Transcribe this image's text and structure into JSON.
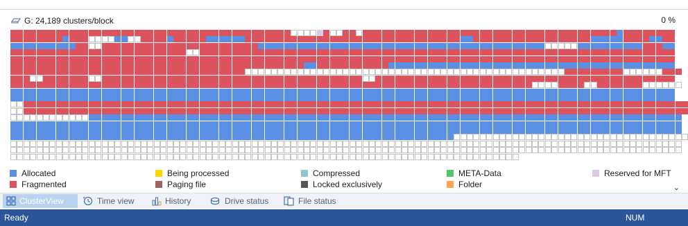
{
  "header": {
    "drive_label": "G: 24,189 clusters/block",
    "percent": "0 %"
  },
  "legend": [
    {
      "label": "Allocated",
      "color": "#5b8fe3"
    },
    {
      "label": "Fragmented",
      "color": "#dd535d"
    },
    {
      "label": "Being processed",
      "color": "#ffd700"
    },
    {
      "label": "Paging file",
      "color": "#a0645f"
    },
    {
      "label": "Compressed",
      "color": "#8fc5d6"
    },
    {
      "label": "Locked exclusively",
      "color": "#555555"
    },
    {
      "label": "META-Data",
      "color": "#52c46a"
    },
    {
      "label": "Folder",
      "color": "#ffa64d"
    },
    {
      "label": "Reserved for MFT",
      "color": "#dccbe3"
    }
  ],
  "tabs": [
    {
      "label": "ClusterView",
      "icon": "grid-icon",
      "active": true
    },
    {
      "label": "Time view",
      "icon": "clock-icon",
      "active": false
    },
    {
      "label": "History",
      "icon": "bar-chart-icon",
      "active": false
    },
    {
      "label": "Drive status",
      "icon": "drive-icon",
      "active": false
    },
    {
      "label": "File status",
      "icon": "file-icon",
      "active": false
    }
  ],
  "status": {
    "text": "Ready",
    "num": "NUM"
  },
  "colors": {
    "allocated": "#5b8fe3",
    "fragmented": "#dd535d",
    "free_border": "#c4c4c4",
    "reserved": "#dccbe3",
    "status_bar": "#2b579a",
    "active_tab": "#b8d3f0"
  },
  "cluster_map": {
    "description_codes": "A=allocated, F=fragmented, E=empty/free, R=reserved for MFT",
    "rows": [
      "FFFFFFFFFFFFFFFFFFFFFFFFFFFFFFFFFFFFFFFFFFFEEEERFEEFFEFFFFFFFFFFFFFFFFFFFFFFFFFFFFFFFFFFFFFFFAFFFFFFFF",
      "FFFFFFFFAFFFEEEEAAEEFFFFAFFFFFAAAAAAFFFFFFFFFFFFFFFFFFFFFFFFFFFFFFFFFAAFFFFFFFFFFFFFFFFFFAAAAAFFFFAAFF",
      "AAAAAAAAAAFFEEFFFFFFFFFFFFFFFFFFFFFFFFAAAAAAAAAAAAAAAAAAAAAAAAAAAAAAAAAAAAAAAAAAAAEEEEEAAAAAAAAAAFFFAA",
      "FFFFFFFFFFFFFFFFFFFFFFFFFFFEEFFFFFFFFFFFFFFFFFFFFFFFFFFFFFFFFFFFFFFFFFFFFFFFFFFFFFFFFFFFFFFFFFFFFFFFFF",
      "FFFFFFFFFFFFFFFFFFFFFFFFFFFFFFFFFFFFFFFFFFFFFFFFFFFFFFFFFFFFFFFFFFFFFFFFFFFFFFFFFFFFFFFFFFFFFFFFFFFFFF",
      "FFFFFFFFFFFFFFFFFFFFFFFFFFFFFFFFFFFFFFFFFFFFFAAFFFFFFFFFFFAAAAAAAAAAAAAAAAAAAAAAAAAAAAAAAAAAAAAAAAAAAA",
      "FFFFFFFFFFFFFFFFFFFFFFFFFFFFFFFFFFFFEEEEEEEEEEEEEEEEEEEEEEEEEEEEEEEEEEEEEEEEEEEEEEEEEFFFFFFFFFEEEEEEFFF",
      "FFFEEFFFFFFFEEFFFFFFFFFFFFFFFFFFFFFFFFFFFFFFFFFFFFFFFFEEFFFFFFFFFFFFFFFFFFFFFFFFFFFFFFFFFFFFFFFFFFFFFF",
      "FFFFFFFFFFFFFFFFFFFFFFFFFFFFFFFFFFFFFFFFFFFFFFFFFFFFFFFFFFFFFFFFFFFFFFFFFFFFFFFFEEEEFFFFEEFFFFFFFEEEEEE",
      "AAAAAAAAAAAAAAAAAAAAAAAAAAAAAAAAAAAAAAAAAAAAAAAAAAAAAAAAAAAAAAAAAAAAAAAAAAAAAAAAAAAAAAAAAAAAAAAAAAAAAA",
      "AAAAAAAAAAAAAAAAAAAAAAAAAAAAAAAAAAAAAAAAAAAAAAAAAAAAAAAAAAAAAAAAAAAAAAAAAAAAAAAAAAAAAAAAAAAAAAAAAAAAAA",
      "EEFFFFFFFFFFFFFFFFFFFFFFFFFFFFFFFFFFFFFFFFFFFFFFFFFFFFFFFFFFFFFFFFFFFFFFFFFFFFFFFFFFFFFFFFFFFFFFFFFFFFFF",
      "EEFFFFFFFFFFFFFFFFFFFFFFFFFFFFFFFFFFFFFFFFFFFFFFFFFFFFFFFFFFFFFFFFFFFFFFFFFFFFFFFFFFFFFFFFFFFFFFFFFFFFFF",
      "EEEEEEEEEEEEAAAAAAAAAAAAAAAAAAAAAAAAAAAAAAAAAAAAAAAAAAAAAAAAAAAAAAAAAAAAAAAAAAAAAAAAAAAAAAAAAAAAAAAAAAA",
      "AAAAAAAAAAAAAAAAAAAAAAAAAAAAAAAAAAAAAAAAAAAAAAAAAAAAAAAAAAAAAAAAAAAAAAAAAAAAAAAAAAAAAAAAAAAAAAAAAAAAAAA",
      "AAAAAAAAAAAAAAAAAAAAAAAAAAAAAAAAAAAAAAAAAAAAAAAAAAAAAAAAAAAAAAAAAAAAAAAAAAAAAAAAAAAAAAAAAAAAAAAAAAAAAAA",
      "AAAAAAAAAAAAAAAAAAAAAAAAAAAAAAAAAAAAAAAAAAAAAAAAAAAAAAAAAAAAAAAAAAAAEEEEEEEEEEEEEEEEEEEEEEEEEEEEEEEEEEEE",
      "EEEEEEEEEEEEEEEEEEEEEEEEEEEEEEEEEEEEEEEEEEEEEEEEEEEEEEEEEEEEEEEEEEEEEEEEEEEEEEEEEEEEEEEEEEEEEEEEEEEEEEE",
      "EEEEEEEEEEEEEEEEEEEEEEEEEEEEEEEEEEEEEEEEEEEEEEEEEEEEEEEEEEEEEEEEEEEEEEEEEEEEEEEEEEEEEEEEEEEEEEEEEEEEEEE",
      "EEEEEEEEEEEEEEEEEEEEEEEEEEEEEEEEEEEEEEEEEEEEEEEEEEEEEEEEEEEEEEEEEEEEEEEEEEEEEE"
    ]
  }
}
